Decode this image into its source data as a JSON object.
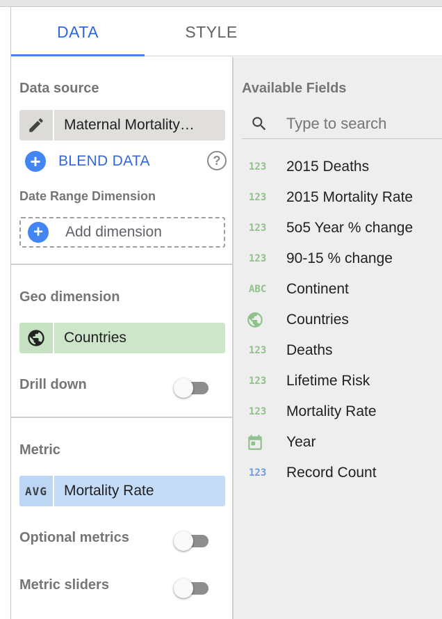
{
  "tabs": [
    {
      "label": "DATA",
      "active": true
    },
    {
      "label": "STYLE",
      "active": false
    }
  ],
  "data_source": {
    "section_label": "Data source",
    "chip_icon": "pencil-icon",
    "chip_label": "Maternal Mortality…",
    "blend_label": "BLEND DATA",
    "help_glyph": "?"
  },
  "date_range": {
    "section_label": "Date Range Dimension",
    "add_label": "Add dimension"
  },
  "geo": {
    "section_label": "Geo dimension",
    "chip_icon": "globe-icon",
    "chip_label": "Countries",
    "drill_label": "Drill down",
    "drill_on": false
  },
  "metric": {
    "section_label": "Metric",
    "agg": "AVG",
    "chip_label": "Mortality Rate",
    "optional_label": "Optional metrics",
    "optional_on": false,
    "sliders_label": "Metric sliders",
    "sliders_on": false
  },
  "available": {
    "label": "Available Fields",
    "search_placeholder": "Type to search",
    "fields": [
      {
        "type": "123",
        "name": "2015 Deaths"
      },
      {
        "type": "123",
        "name": "2015 Mortality Rate"
      },
      {
        "type": "123",
        "name": "5o5 Year % change"
      },
      {
        "type": "123",
        "name": "90-15 % change"
      },
      {
        "type": "ABC",
        "name": "Continent"
      },
      {
        "type": "globe",
        "name": "Countries"
      },
      {
        "type": "123",
        "name": "Deaths"
      },
      {
        "type": "123",
        "name": "Lifetime Risk"
      },
      {
        "type": "123",
        "name": "Mortality Rate"
      },
      {
        "type": "calendar",
        "name": "Year"
      },
      {
        "type": "123",
        "name": "Record Count"
      }
    ]
  },
  "colors": {
    "accent": "#4285f4",
    "dimension_green": "#8fc18a",
    "metric_blue": "#6f9be0"
  }
}
